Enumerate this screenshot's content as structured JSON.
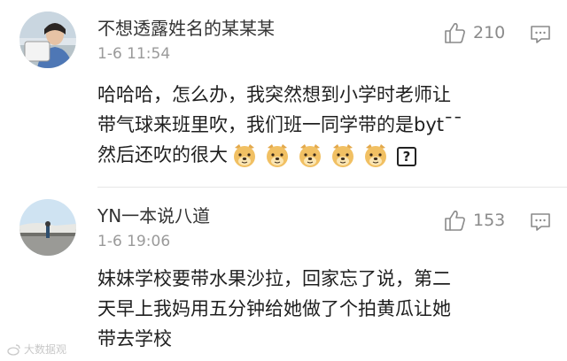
{
  "comments": [
    {
      "username": "不想透露姓名的某某某",
      "time": "1-6 11:54",
      "likes": "210",
      "lines": [
        "哈哈哈，怎么办，我突然想到小学时老师让",
        "带气球来班里吹，我们班一同学带的是byt¯¯",
        "然后还吹的很大"
      ],
      "emoji_count": 5,
      "unknown_glyph": "?"
    },
    {
      "username": "YN一本说八道",
      "time": "1-6 19:06",
      "likes": "153",
      "lines": [
        "妹妹学校要带水果沙拉，回家忘了说，第二",
        "天早上我妈用五分钟给她做了个拍黄瓜让她",
        "带去学校"
      ]
    }
  ],
  "icons": {
    "like": "thumbs-up-icon",
    "reply": "comment-icon",
    "emoji": "doge-emoji-icon"
  },
  "watermark": "大数据观"
}
